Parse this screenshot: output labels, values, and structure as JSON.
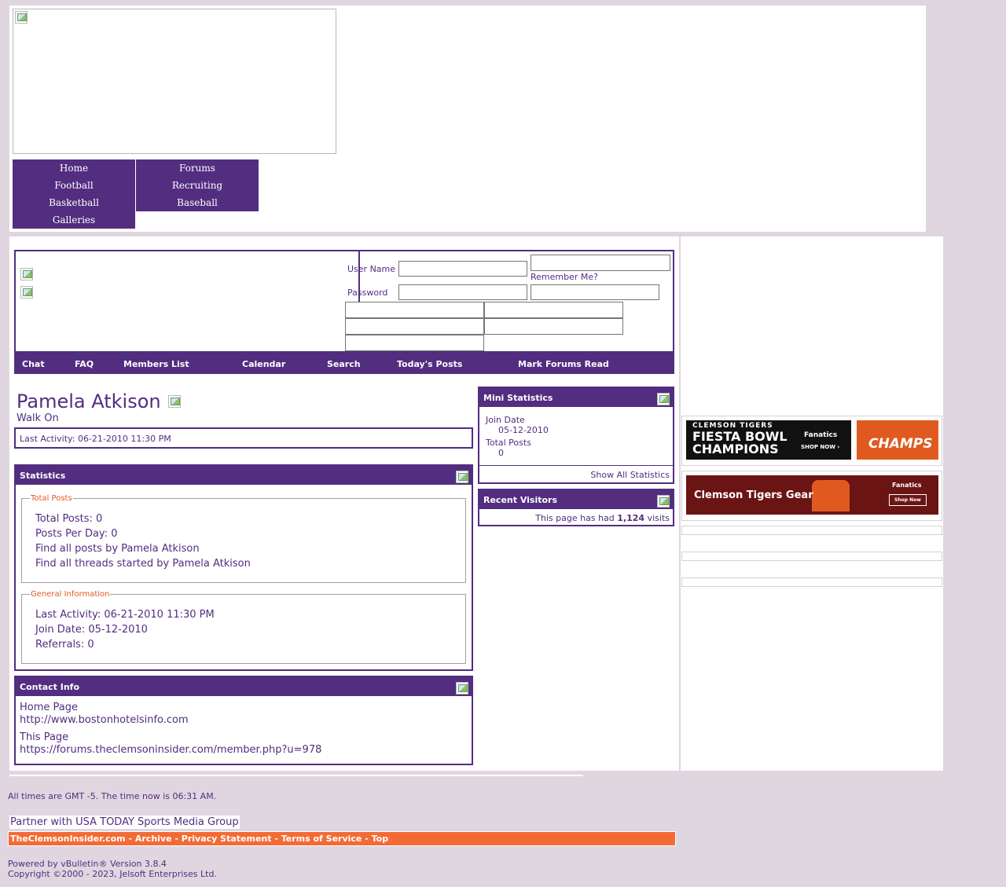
{
  "nav_primary": [
    "Home",
    "Football",
    "Basketball",
    "Galleries"
  ],
  "nav_secondary": [
    "Forums",
    "Recruiting",
    "Baseball"
  ],
  "login": {
    "username_label": "User Name",
    "password_label": "Password",
    "remember_label": "Remember Me?"
  },
  "navbar": [
    "Chat",
    "FAQ",
    "Members List",
    "Calendar",
    "Search",
    "Today's Posts",
    "Mark Forums Read"
  ],
  "profile": {
    "username": "Pamela Atkison",
    "usertitle": "Walk On",
    "last_activity": "Last Activity: 06-21-2010 11:30 PM"
  },
  "statistics": {
    "title": "Statistics",
    "total_posts_legend": "Total Posts",
    "total_posts": "Total Posts: 0",
    "posts_per_day": "Posts Per Day: 0",
    "find_posts": "Find all posts by Pamela Atkison",
    "find_threads": "Find all threads started by Pamela Atkison",
    "general_legend": "General Information",
    "last_activity": "Last Activity: 06-21-2010 11:30 PM",
    "join_date": "Join Date: 05-12-2010",
    "referrals": "Referrals: 0"
  },
  "contact": {
    "title": "Contact Info",
    "home_label": "Home Page",
    "home_url": "http://www.bostonhotelsinfo.com",
    "this_label": "This Page",
    "this_url": "https://forums.theclemsoninsider.com/member.php?u=978"
  },
  "mini_stats": {
    "title": "Mini Statistics",
    "join_label": "Join Date",
    "join_value": "05-12-2010",
    "posts_label": "Total Posts",
    "posts_value": "0",
    "show_all": "Show All Statistics"
  },
  "visitors": {
    "title": "Recent Visitors",
    "prefix": "This page has had",
    "count": "1,124",
    "suffix": "visits"
  },
  "ads": {
    "ad1_top": "CLEMSON TIGERS",
    "ad1_main1": "FIESTA BOWL",
    "ad1_main2": "CHAMPIONS",
    "ad1_brand": "Fanatics",
    "ad1_cta": "SHOP NOW ›",
    "ad1_shirt": "CHAMPS",
    "ad2_main": "Clemson Tigers Gear",
    "ad2_brand": "Fanatics",
    "ad2_cta": "Shop Now"
  },
  "footer": {
    "timezone": "All times are GMT -5. The time now is 06:31 AM.",
    "partner": "Partner with USA TODAY Sports Media Group",
    "links": "TheClemsonInsider.com - Archive - Privacy Statement - Terms of Service - Top",
    "powered": "Powered by vBulletin® Version 3.8.4",
    "copyright": "Copyright ©2000 - 2023, Jelsoft Enterprises Ltd."
  },
  "colors": {
    "purple": "#522d80",
    "orange": "#f26b35",
    "background": "#e0d6e0"
  }
}
